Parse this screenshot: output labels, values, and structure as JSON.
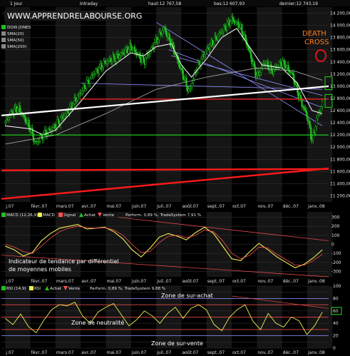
{
  "header": {
    "period": "1 Jour",
    "mode": "Intraday",
    "high": "haut:12 767,58",
    "low": "bas:12 607,93",
    "last": "dernier:12 743,19"
  },
  "watermark": "WWW.APPRENDRELABOURSE.ORG",
  "colors": {
    "background": "#000000",
    "panel": "#161616",
    "candle": "#21c021",
    "sma20": "#ffffff",
    "sma50": "#d8d8d8",
    "sma200": "#b5b5b5",
    "macd": "#f2ee55",
    "signal": "#ff5050",
    "rsi": "#f2ee55",
    "support_red": "#ff1a1a",
    "support_green": "#1edc1e",
    "trend_white": "#ffffff",
    "trend_blue": "#8f8fff",
    "death_cross": "#ff7a1c"
  },
  "legend_price": {
    "items": [
      {
        "label": "DOW JONES",
        "icon": "green-square-icon"
      },
      {
        "label": "SMA(20)",
        "icon": "grey-square-icon"
      },
      {
        "label": "SMA(50)",
        "icon": "grey-square-icon"
      },
      {
        "label": "SMA(200)",
        "icon": "grey-square-icon"
      }
    ]
  },
  "legend_macd": {
    "items": [
      {
        "label": "MACD (12,26,9)",
        "icon": "green-square-icon"
      },
      {
        "label": "MACD",
        "icon": "yellow-square-icon"
      },
      {
        "label": "Signal",
        "icon": "red-square-icon"
      },
      {
        "label": "Achat",
        "icon": "triangle-up-icon"
      },
      {
        "label": "Vente",
        "icon": "triangle-down-icon"
      }
    ],
    "stats": "Perform. 0,89 %, TradeSystem 7,91 %"
  },
  "legend_rsi": {
    "items": [
      {
        "label": "RSI (14,9)",
        "icon": "green-square-icon"
      },
      {
        "label": "RSI",
        "icon": "yellow-square-icon"
      },
      {
        "label": "Achat",
        "icon": "triangle-up-icon"
      },
      {
        "label": "Vente",
        "icon": "triangle-down-icon"
      }
    ],
    "stats": "Perform. 0,89 %, TradeSystem 9,88 %"
  },
  "annotations": {
    "death_cross_1": "DEATH",
    "death_cross_2": "CROSS",
    "macd_note_1": "Indicateur de tendance par différentiel",
    "macd_note_2": "de moyennes mobiles",
    "overbought": "Zone de sur-achat",
    "neutral": "Zone de neutralité",
    "oversold": "Zone de sur-vente"
  },
  "chart_data": [
    {
      "type": "candlestick",
      "instrument": "DOW JONES",
      "x_labels": [
        "j.07",
        "févr..07",
        "mars.07",
        "avr..07",
        "mai.07",
        "juin.07",
        "juil..07",
        "août.07",
        "sept..07",
        "oct.07",
        "nov..07",
        "déc..07",
        "janv..08"
      ],
      "y_ticks": [
        11200,
        11400,
        11600,
        11800,
        12000,
        12200,
        12400,
        12600,
        12800,
        13000,
        13200,
        13400,
        13600,
        13800,
        14000,
        14200
      ],
      "y_tick_labels": [
        "11 200,00",
        "11 400,00",
        "11 600,00",
        "11 800,00",
        "12 000,00",
        "12 200,00",
        "12 400,00",
        "12 600,00",
        "12 800,00",
        "13 000,00",
        "13 200,00",
        "13 400,00",
        "13 600,00",
        "13 800,00",
        "14 000,00",
        "14 200,00"
      ],
      "ylim": [
        11100,
        14300
      ],
      "highlighted_levels": [
        13400,
        12800,
        12200
      ],
      "close_path": [
        {
          "x": 0,
          "y": 12400
        },
        {
          "x": 0.2,
          "y": 12550
        },
        {
          "x": 0.5,
          "y": 12650
        },
        {
          "x": 0.8,
          "y": 12450
        },
        {
          "x": 1.0,
          "y": 12300
        },
        {
          "x": 1.2,
          "y": 12050
        },
        {
          "x": 1.5,
          "y": 12200
        },
        {
          "x": 2.0,
          "y": 12350
        },
        {
          "x": 2.5,
          "y": 12600
        },
        {
          "x": 3.0,
          "y": 12900
        },
        {
          "x": 3.5,
          "y": 13200
        },
        {
          "x": 4.0,
          "y": 13400
        },
        {
          "x": 4.5,
          "y": 13500
        },
        {
          "x": 5.0,
          "y": 13650
        },
        {
          "x": 5.5,
          "y": 13400
        },
        {
          "x": 6.0,
          "y": 13750
        },
        {
          "x": 6.3,
          "y": 13950
        },
        {
          "x": 6.6,
          "y": 13700
        },
        {
          "x": 7.0,
          "y": 13250
        },
        {
          "x": 7.3,
          "y": 12900
        },
        {
          "x": 7.6,
          "y": 13300
        },
        {
          "x": 8.0,
          "y": 13600
        },
        {
          "x": 8.5,
          "y": 13850
        },
        {
          "x": 9.0,
          "y": 14100
        },
        {
          "x": 9.3,
          "y": 14000
        },
        {
          "x": 9.6,
          "y": 13700
        },
        {
          "x": 10.0,
          "y": 13150
        },
        {
          "x": 10.3,
          "y": 13400
        },
        {
          "x": 10.6,
          "y": 13250
        },
        {
          "x": 11.0,
          "y": 13400
        },
        {
          "x": 11.4,
          "y": 13200
        },
        {
          "x": 11.7,
          "y": 12800
        },
        {
          "x": 12.0,
          "y": 12500
        },
        {
          "x": 12.2,
          "y": 12100
        },
        {
          "x": 12.4,
          "y": 12500
        },
        {
          "x": 12.6,
          "y": 12700
        }
      ],
      "sma20": [
        {
          "x": 0,
          "y": 12350
        },
        {
          "x": 1,
          "y": 12300
        },
        {
          "x": 1.5,
          "y": 12200
        },
        {
          "x": 2,
          "y": 12280
        },
        {
          "x": 3,
          "y": 12750
        },
        {
          "x": 4,
          "y": 13250
        },
        {
          "x": 5,
          "y": 13550
        },
        {
          "x": 5.5,
          "y": 13500
        },
        {
          "x": 6,
          "y": 13650
        },
        {
          "x": 6.6,
          "y": 13700
        },
        {
          "x": 7,
          "y": 13350
        },
        {
          "x": 7.4,
          "y": 13150
        },
        {
          "x": 8,
          "y": 13450
        },
        {
          "x": 8.6,
          "y": 13800
        },
        {
          "x": 9.2,
          "y": 13950
        },
        {
          "x": 9.7,
          "y": 13650
        },
        {
          "x": 10.2,
          "y": 13350
        },
        {
          "x": 11,
          "y": 13300
        },
        {
          "x": 11.6,
          "y": 13050
        },
        {
          "x": 12.2,
          "y": 12600
        },
        {
          "x": 12.6,
          "y": 12550
        }
      ],
      "sma200": [
        {
          "x": 0,
          "y": 12050
        },
        {
          "x": 2,
          "y": 12200
        },
        {
          "x": 4,
          "y": 12550
        },
        {
          "x": 6,
          "y": 12950
        },
        {
          "x": 8,
          "y": 13150
        },
        {
          "x": 10,
          "y": 13300
        },
        {
          "x": 11.5,
          "y": 13250
        },
        {
          "x": 12.6,
          "y": 13100
        }
      ]
    },
    {
      "type": "line",
      "name": "MACD (12,26,9)",
      "y_ticks": [
        -300,
        -200,
        -100,
        0,
        100,
        200,
        300
      ],
      "ylim": [
        -360,
        360
      ],
      "series": [
        {
          "name": "MACD",
          "values": [
            -20,
            -60,
            -130,
            -90,
            40,
            120,
            180,
            200,
            220,
            170,
            180,
            190,
            140,
            60,
            -60,
            -140,
            -40,
            80,
            120,
            90,
            50,
            130,
            190,
            120,
            -20,
            -160,
            -180,
            -80,
            10,
            -60,
            -140,
            -200,
            -260,
            -220,
            -150,
            -60
          ]
        },
        {
          "name": "Signal",
          "values": [
            0,
            -30,
            -80,
            -100,
            -20,
            70,
            140,
            180,
            200,
            185,
            180,
            185,
            160,
            100,
            0,
            -90,
            -80,
            20,
            90,
            100,
            75,
            100,
            160,
            140,
            40,
            -100,
            -160,
            -120,
            -30,
            -40,
            -110,
            -170,
            -230,
            -230,
            -180,
            -110
          ]
        }
      ]
    },
    {
      "type": "line",
      "name": "RSI (14,9)",
      "y_ticks": [
        0,
        10,
        20,
        30,
        40,
        50,
        60,
        70,
        80,
        90,
        100
      ],
      "ylim": [
        0,
        100
      ],
      "highlighted_levels": [
        80,
        70,
        50,
        30,
        20
      ],
      "series": [
        {
          "name": "RSI",
          "values": [
            48,
            38,
            55,
            35,
            25,
            45,
            62,
            70,
            68,
            74,
            52,
            40,
            58,
            66,
            72,
            54,
            36,
            46,
            60,
            52,
            40,
            56,
            66,
            48,
            64,
            70,
            62,
            38,
            28,
            50,
            62,
            70,
            44,
            30,
            56,
            40,
            34,
            50,
            44,
            22,
            36,
            58
          ]
        }
      ]
    }
  ]
}
